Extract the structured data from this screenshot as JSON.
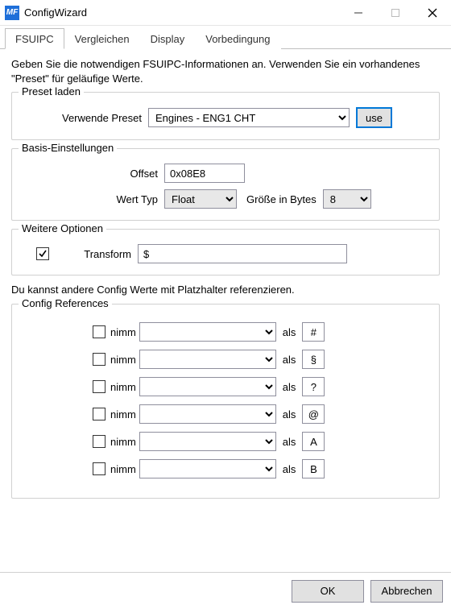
{
  "window": {
    "title": "ConfigWizard",
    "icon_text": "MF"
  },
  "tabs": [
    {
      "label": "FSUIPC",
      "active": true
    },
    {
      "label": "Vergleichen"
    },
    {
      "label": "Display"
    },
    {
      "label": "Vorbedingung"
    }
  ],
  "intro": "Geben Sie die notwendigen FSUIPC-Informationen an. Verwenden Sie ein vorhandenes \"Preset\" für geläufige Werte.",
  "preset": {
    "group_title": "Preset laden",
    "label": "Verwende Preset",
    "value": "Engines - ENG1 CHT",
    "use_label": "use"
  },
  "basis": {
    "group_title": "Basis-Einstellungen",
    "offset_label": "Offset",
    "offset_value": "0x08E8",
    "type_label": "Wert Typ",
    "type_value": "Float",
    "size_label": "Größe in Bytes",
    "size_value": "8"
  },
  "options": {
    "group_title": "Weitere Optionen",
    "transform_label": "Transform",
    "transform_checked": true,
    "transform_value": "$"
  },
  "ref_note": "Du kannst andere Config Werte mit Platzhalter referenzieren.",
  "refs": {
    "group_title": "Config References",
    "take_label": "nimm",
    "as_label": "als",
    "items": [
      {
        "symbol": "#"
      },
      {
        "symbol": "§"
      },
      {
        "symbol": "?"
      },
      {
        "symbol": "@"
      },
      {
        "symbol": "A"
      },
      {
        "symbol": "B"
      }
    ]
  },
  "footer": {
    "ok": "OK",
    "cancel": "Abbrechen"
  }
}
